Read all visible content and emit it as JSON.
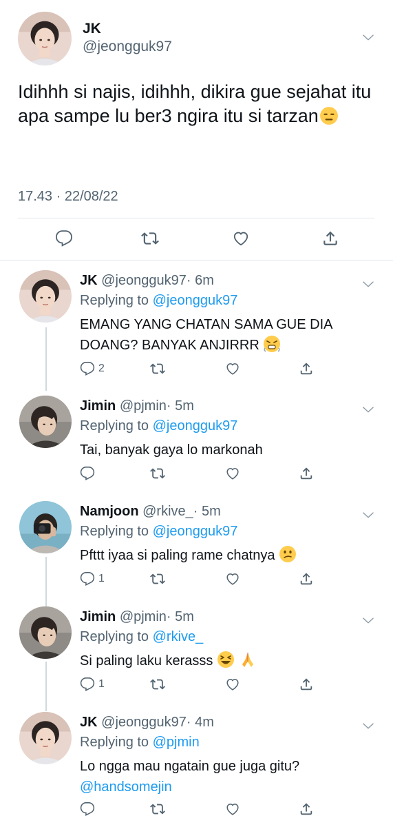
{
  "main_tweet": {
    "name": "JK",
    "handle": "@jeongguk97",
    "text": "Idihhh si najis, idihhh, dikira gue sejahat itu apa sampe lu ber3 ngira itu si tarzan",
    "emoji": "expressionless-face",
    "timestamp": "17.43 · 22/08/22"
  },
  "replies": [
    {
      "name": "JK",
      "handle": "@jeongguk97",
      "time": "· 6m",
      "replying_label": "Replying to",
      "replying_to": "@jeongguk97",
      "text": "EMANG YANG CHATAN SAMA GUE DIA DOANG? BANYAK ANJIRRR",
      "emoji": "steam-face",
      "reply_count": "2",
      "avatar": "jk"
    },
    {
      "name": "Jimin",
      "handle": "@pjmin",
      "time": "· 5m",
      "replying_label": "Replying to",
      "replying_to": "@jeongguk97",
      "text": "Tai, banyak gaya lo markonah",
      "reply_count": "",
      "avatar": "jimin"
    },
    {
      "name": "Namjoon",
      "handle": "@rkive_",
      "time": "· 5m",
      "replying_label": "Replying to",
      "replying_to": "@jeongguk97",
      "text": "Pfttt iyaa si paling rame chatnya",
      "emoji": "confused-face",
      "reply_count": "1",
      "avatar": "namjoon"
    },
    {
      "name": "Jimin",
      "handle": "@pjmin",
      "time": "· 5m",
      "replying_label": "Replying to",
      "replying_to": "@rkive_",
      "text": "Si paling laku kerasss",
      "emoji": "laughing-face + folded-hands",
      "reply_count": "1",
      "avatar": "jimin"
    },
    {
      "name": "JK",
      "handle": "@jeongguk97",
      "time": "· 4m",
      "replying_label": "Replying to",
      "replying_to": "@pjmin",
      "text": "Lo ngga mau ngatain gue juga gitu?",
      "mention": "@handsomejin",
      "reply_count": "",
      "avatar": "jk"
    }
  ],
  "colors": {
    "text": "#0f1419",
    "secondary": "#536471",
    "link": "#1d9bf0",
    "divider": "#e1e8ed",
    "thread_line": "#cfd9de"
  }
}
